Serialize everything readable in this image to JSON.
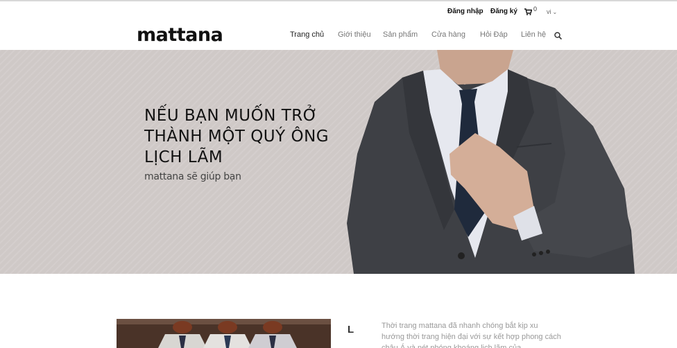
{
  "header": {
    "utility": {
      "login": "Đăng nhập",
      "register": "Đăng ký",
      "cart_count": "0",
      "language": "vi"
    },
    "logo": "mattana",
    "nav": {
      "home": "Trang chủ",
      "about": "Giới thiệu",
      "products": "Sản phẩm",
      "stores": "Cửa hàng",
      "faq": "Hỏi Đáp",
      "contact": "Liên hệ"
    }
  },
  "hero": {
    "title": "NẾU BẠN MUỐN TRỞ THÀNH MỘT QUÝ ÔNG LỊCH LÃM",
    "subtitle": "mattana sẽ giúp bạn"
  },
  "content": {
    "heading_partial": "L",
    "text": "Thời trang mattana đã nhanh chóng bắt kịp xu hướng thời trang hiện đại với sự kết hợp phong cách châu Á và nét phóng khoáng lịch lãm của"
  },
  "colors": {
    "hero_bg": "#cfc9c7",
    "suit": "#3e4045",
    "text_dark": "#111111",
    "nav_inactive": "#777777"
  }
}
